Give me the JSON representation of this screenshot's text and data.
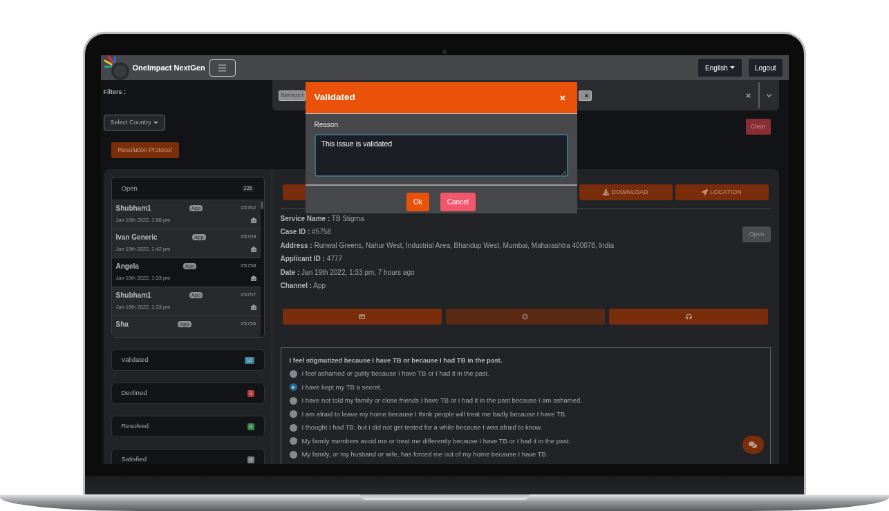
{
  "header": {
    "title": "OneImpact NextGen",
    "language": "English",
    "logout": "Logout"
  },
  "filters": {
    "label": "Filters :",
    "country_select": "Select Country",
    "tags": [
      {
        "label": "Barriers t",
        "remove_visible": false
      },
      {
        "remove_visible": true
      }
    ],
    "clear": "Clear",
    "protocol_button": "Resolution Protocol"
  },
  "sections": [
    {
      "title": "Open",
      "count": "225",
      "color": "#202124",
      "expanded": true,
      "items": [
        {
          "name": "Shubham1",
          "channel": "App",
          "id": "#5762",
          "date": "Jan 19th 2022, 1:56 pm",
          "selected": false
        },
        {
          "name": "Ivan Generic",
          "channel": "App",
          "id": "#5759",
          "date": "Jan 19th 2022, 1:42 pm",
          "selected": false
        },
        {
          "name": "Angela",
          "channel": "App",
          "id": "#5758",
          "date": "Jan 19th 2022, 1:33 pm",
          "selected": true
        },
        {
          "name": "Shubham1",
          "channel": "App",
          "id": "#5757",
          "date": "Jan 19th 2022, 1:33 pm",
          "selected": false
        },
        {
          "name": "Sha",
          "channel": "App",
          "id": "#5756",
          "selected": false
        }
      ]
    },
    {
      "title": "Validated",
      "count": "18",
      "color": "#3a8599",
      "expanded": false
    },
    {
      "title": "Declined",
      "count": "3",
      "color": "#b33a3c",
      "expanded": false
    },
    {
      "title": "Resolved",
      "count": "4",
      "color": "#3a8a48",
      "expanded": false
    },
    {
      "title": "Satisfied",
      "count": "3",
      "color": "#7a7b7e",
      "expanded": false
    }
  ],
  "toolbar": [
    {
      "kind": "blank"
    },
    {
      "kind": "download",
      "label": "DOWNLOAD"
    },
    {
      "kind": "location",
      "label": "LOCATION"
    }
  ],
  "details": [
    {
      "label": "Service Name :",
      "value": "TB Stigma"
    },
    {
      "label": "Case ID :",
      "value": "#5758"
    },
    {
      "label": "Address :",
      "value": "Runwal Greens, Nahur West, Industrial Area, Bhandup West, Mumbai, Maharashtra 400078, India"
    },
    {
      "label": "Applicant ID :",
      "value": "4777"
    },
    {
      "label": "Date :",
      "value": "Jan 19th 2022, 1:33 pm, 7 hours ago"
    },
    {
      "label": "Channel :",
      "value": "App"
    }
  ],
  "status_button": "Open",
  "media_buttons": [
    {
      "kind": "image",
      "disabled": false
    },
    {
      "kind": "video",
      "disabled": true
    },
    {
      "kind": "audio",
      "disabled": false
    }
  ],
  "question": {
    "text": "I feel stigmatized because I have TB or because I had TB in the past.",
    "options": [
      {
        "text": "I feel ashamed or guilty because I have TB or I had it in the past.",
        "selected": false
      },
      {
        "text": "I have kept my TB a secret.",
        "selected": true
      },
      {
        "text": "I have not told my family or close friends I have TB or I had it in the past because I am ashamed.",
        "selected": false
      },
      {
        "text": "I am afraid to leave my home because I think people will treat me badly because I have TB.",
        "selected": false
      },
      {
        "text": "I thought I had TB, but I did not get tested for a while because I was afraid to know.",
        "selected": false
      },
      {
        "text": "My family members avoid me or treat me differently because I have TB or I had it in the past.",
        "selected": false
      },
      {
        "text": "My family, or my husband or wife, has forced me out of my home because I have TB.",
        "selected": false
      }
    ]
  },
  "modal": {
    "title": "Validated",
    "reason_label": "Reason",
    "reason": "This issue is validated",
    "buttons": [
      {
        "kind": "primary",
        "label": "Ok"
      },
      {
        "kind": "danger",
        "label": "Cancel"
      }
    ]
  }
}
